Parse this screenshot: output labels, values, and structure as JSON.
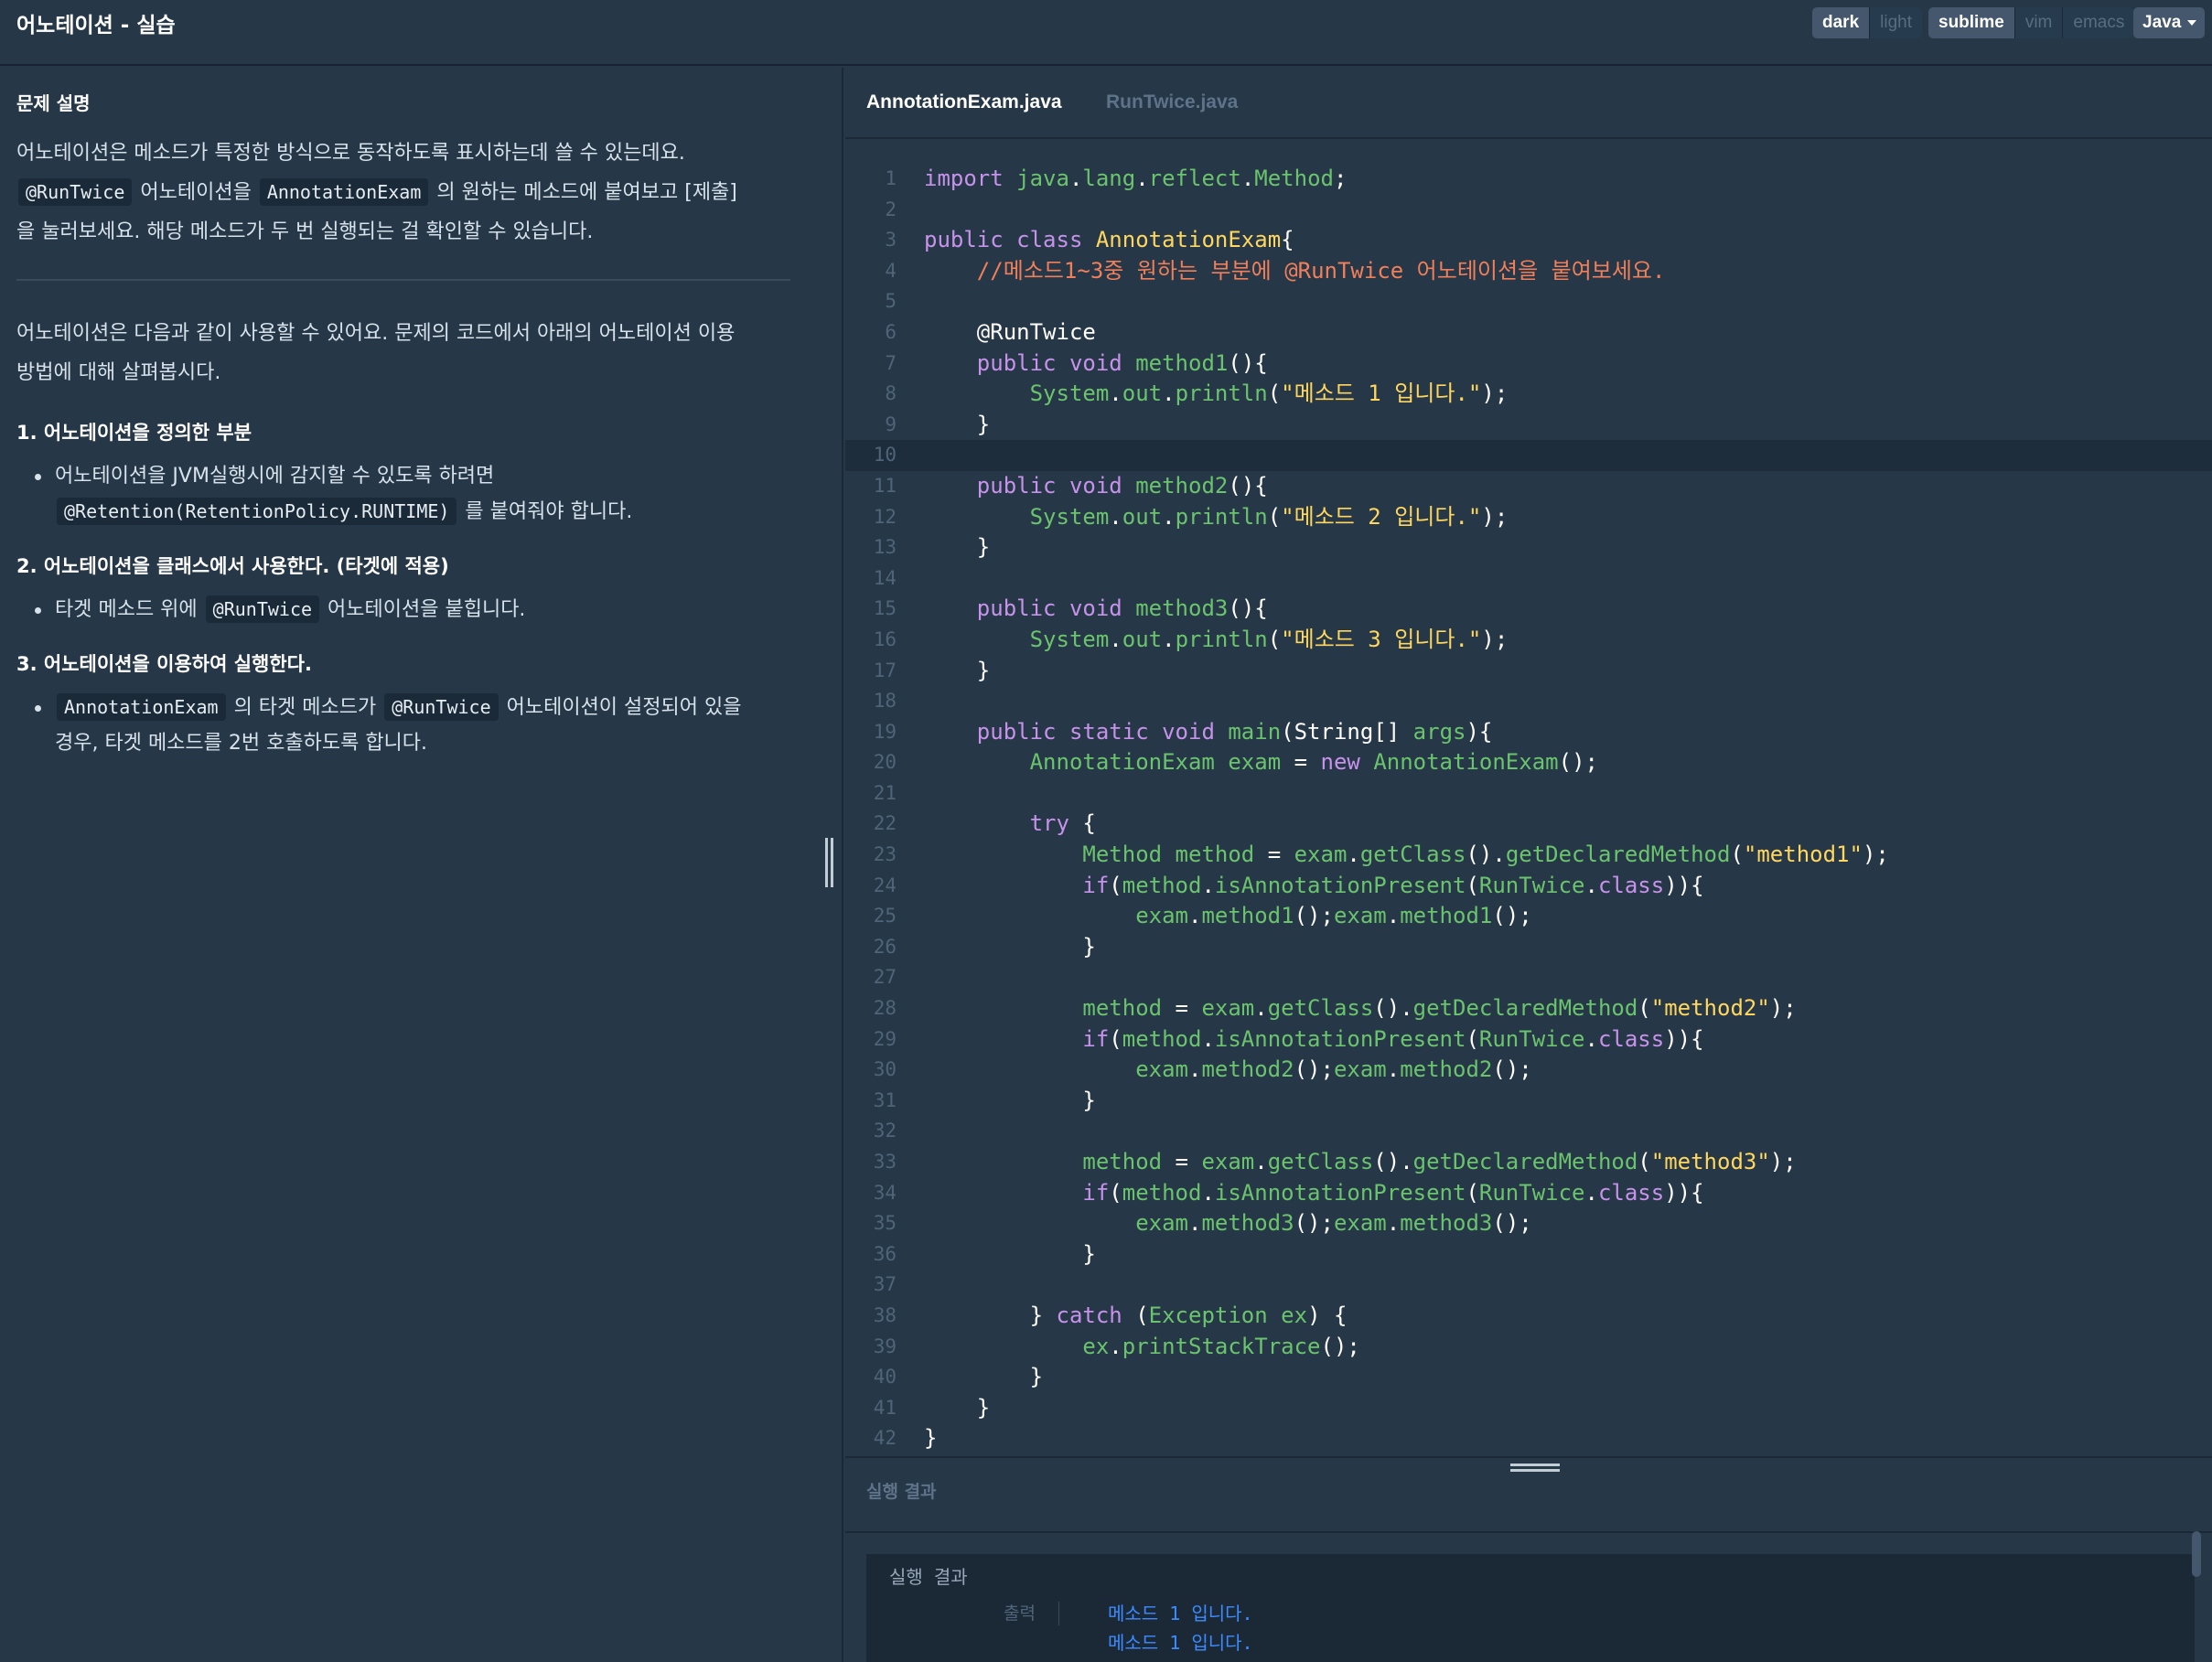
{
  "header": {
    "title": "어노테이션 - 실습",
    "theme_options": [
      "dark",
      "light"
    ],
    "keymap_options": [
      "sublime",
      "vim",
      "emacs"
    ],
    "language": "Java"
  },
  "left": {
    "section_title": "문제 설명",
    "intro": {
      "t1": "어노테이션은 메소드가 특정한 방식으로 동작하도록 표시하는데 쓸 수 있는데요.",
      "c1": "@RunTwice",
      "t2": " 어노테이션을 ",
      "c2": "AnnotationExam",
      "t3": " 의 원하는 메소드에 붙여보고 [제출]",
      "t4": "을 눌러보세요. 해당 메소드가 두 번 실행되는 걸 확인할 수 있습니다."
    },
    "usage_intro": {
      "l1": "어노테이션은 다음과 같이 사용할 수 있어요. 문제의 코드에서 아래의 어노테이션 이용",
      "l2": "방법에 대해 살펴봅시다."
    },
    "step1": {
      "heading": "1. 어노테이션을 정의한 부분",
      "t1": "어노테이션을 JVM실행시에 감지할 수 있도록 하려면",
      "c1": "@Retention(RetentionPolicy.RUNTIME)",
      "t2": " 를 붙여줘야 합니다."
    },
    "step2": {
      "heading": "2. 어노테이션을 클래스에서 사용한다. (타겟에 적용)",
      "t1": "타겟 메소드 위에 ",
      "c1": "@RunTwice",
      "t2": " 어노테이션을 붙힙니다."
    },
    "step3": {
      "heading": "3. 어노테이션을 이용하여 실행한다.",
      "c1": "AnnotationExam",
      "t1": " 의 타겟 메소드가 ",
      "c2": "@RunTwice",
      "t2": " 어노테이션이 설정되어 있을",
      "t3": "경우, 타겟 메소드를 2번 호출하도록 합니다."
    }
  },
  "editor": {
    "tabs": [
      "AnnotationExam.java",
      "RunTwice.java"
    ],
    "active_tab": "AnnotationExam.java",
    "highlighted_line": 10,
    "code_lines": [
      "import java.lang.reflect.Method;",
      "",
      "public class AnnotationExam{",
      "    //메소드1~3중 원하는 부분에 @RunTwice 어노테이션을 붙여보세요.",
      "",
      "    @RunTwice",
      "    public void method1(){",
      "        System.out.println(\"메소드 1 입니다.\");",
      "    }",
      "",
      "    public void method2(){",
      "        System.out.println(\"메소드 2 입니다.\");",
      "    }",
      "",
      "    public void method3(){",
      "        System.out.println(\"메소드 3 입니다.\");",
      "    }",
      "",
      "    public static void main(String[] args){",
      "        AnnotationExam exam = new AnnotationExam();",
      "",
      "        try {",
      "            Method method = exam.getClass().getDeclaredMethod(\"method1\");",
      "            if(method.isAnnotationPresent(RunTwice.class)){",
      "                exam.method1();exam.method1();",
      "            }",
      "",
      "            method = exam.getClass().getDeclaredMethod(\"method2\");",
      "            if(method.isAnnotationPresent(RunTwice.class)){",
      "                exam.method2();exam.method2();",
      "            }",
      "",
      "            method = exam.getClass().getDeclaredMethod(\"method3\");",
      "            if(method.isAnnotationPresent(RunTwice.class)){",
      "                exam.method3();exam.method3();",
      "            }",
      "",
      "        } catch (Exception ex) {",
      "            ex.printStackTrace();",
      "        }",
      "    }",
      "}"
    ]
  },
  "output": {
    "title": "실행 결과",
    "console_title": "실행 결과",
    "label": "출력",
    "lines": [
      "메소드 1 입니다.",
      "메소드 1 입니다."
    ]
  },
  "colors": {
    "background": "#263747",
    "keyword": "#c792ea",
    "identifier": "#6bc46d",
    "class_name": "#ffd75e",
    "string": "#ffd75e",
    "comment": "#f07f5a",
    "console_output": "#3d8bff"
  }
}
